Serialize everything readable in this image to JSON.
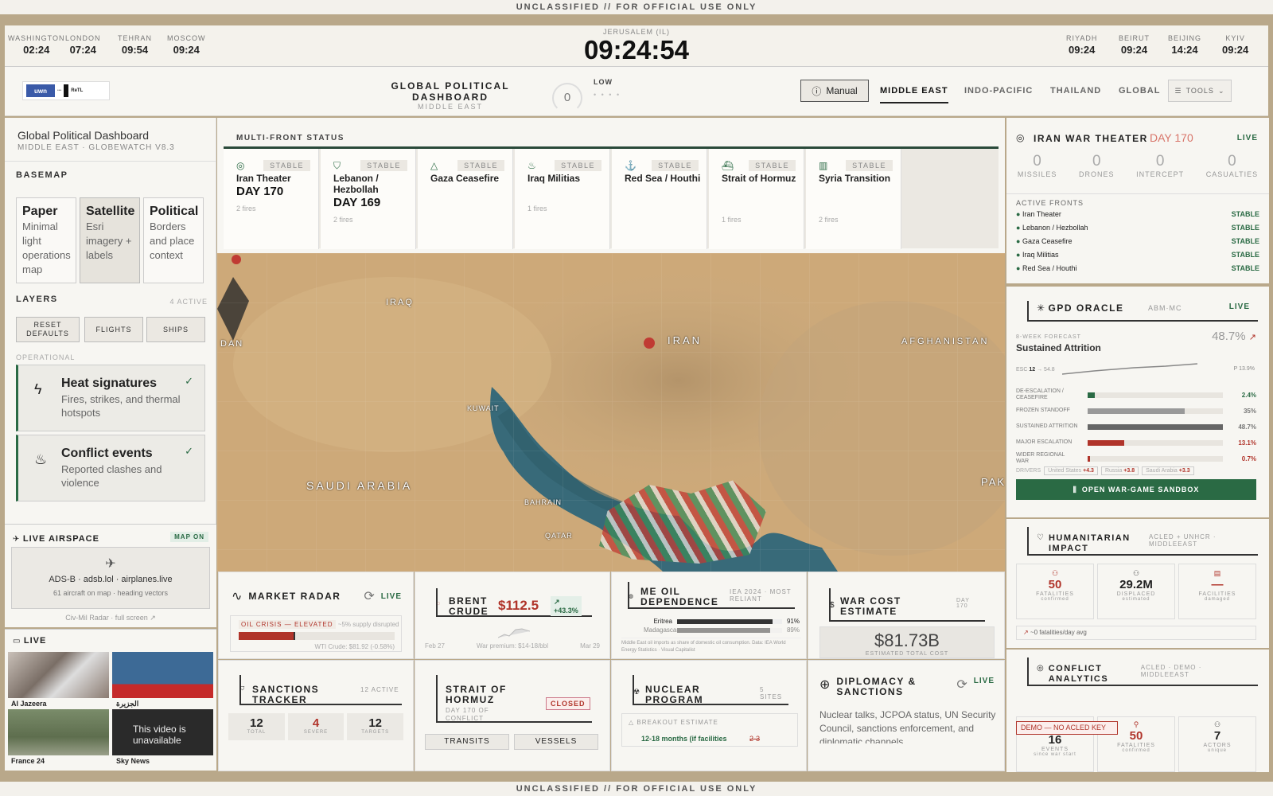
{
  "classification": "UNCLASSIFIED // FOR OFFICIAL USE ONLY",
  "clocks": [
    {
      "city": "WASHINGTON",
      "time": "02:24"
    },
    {
      "city": "LONDON",
      "time": "07:24"
    },
    {
      "city": "TEHRAN",
      "time": "09:54"
    },
    {
      "city": "MOSCOW",
      "time": "09:24"
    },
    {
      "city": "RIYADH",
      "time": "09:24"
    },
    {
      "city": "BEIRUT",
      "time": "09:24"
    },
    {
      "city": "BEIJING",
      "time": "14:24"
    },
    {
      "city": "KYIV",
      "time": "09:24"
    }
  ],
  "main_clock": {
    "city": "JERUSALEM (IL)",
    "time": "09:24:54"
  },
  "header": {
    "logos": {
      "uwn": "uwn",
      "alt": "ReTL"
    },
    "title": "GLOBAL POLITICAL DASHBOARD",
    "subtitle": "MIDDLE EAST",
    "gauge_value": "0",
    "risk_label": "LOW",
    "risk_dots": "• • • •",
    "manual": "Manual",
    "tabs": [
      "MIDDLE EAST",
      "INDO-PACIFIC",
      "THAILAND",
      "GLOBAL"
    ],
    "tools": "TOOLS"
  },
  "left": {
    "title": "Global Political Dashboard",
    "subtitle": "MIDDLE EAST · GLOBEWATCH V8.3",
    "basemap_h": "BASEMAP",
    "basemaps": [
      {
        "name": "Paper",
        "desc": "Minimal light operations map"
      },
      {
        "name": "Satellite",
        "desc": "Esri imagery + labels"
      },
      {
        "name": "Political",
        "desc": "Borders and place context"
      }
    ],
    "layers_h": "LAYERS",
    "layers_count": "4 ACTIVE",
    "buttons": [
      "RESET DEFAULTS",
      "FLIGHTS",
      "SHIPS"
    ],
    "operational": "OPERATIONAL",
    "layers": [
      {
        "name": "Heat signatures",
        "desc": "Fires, strikes, and thermal hotspots"
      },
      {
        "name": "Conflict events",
        "desc": "Reported clashes and violence"
      }
    ],
    "air": {
      "title": "LIVE AIRSPACE",
      "mapon": "MAP ON",
      "src": "ADS-B · adsb.lol · airplanes.live",
      "detail": "61 aircraft on map · heading vectors",
      "link": "Civ-Mil Radar · full screen"
    },
    "live": {
      "title": "LIVE",
      "videos": [
        "Al Jazeera",
        "الجزيرة",
        "France 24",
        "Sky News"
      ],
      "unavailable": "This video is unavailable"
    }
  },
  "multifront": {
    "title": "MULTI-FRONT STATUS",
    "fronts": [
      {
        "name": "Iran Theater",
        "day": "DAY 170",
        "fires": "2 fires",
        "status": "STABLE"
      },
      {
        "name": "Lebanon / Hezbollah",
        "day": "DAY 169",
        "fires": "2 fires",
        "status": "STABLE"
      },
      {
        "name": "Gaza Ceasefire",
        "day": "",
        "fires": "",
        "status": "STABLE"
      },
      {
        "name": "Iraq Militias",
        "day": "",
        "fires": "1 fires",
        "status": "STABLE"
      },
      {
        "name": "Red Sea / Houthi",
        "day": "",
        "fires": "",
        "status": "STABLE"
      },
      {
        "name": "Strait of Hormuz",
        "day": "",
        "fires": "1 fires",
        "status": "STABLE"
      },
      {
        "name": "Syria Transition",
        "day": "",
        "fires": "2 fires",
        "status": "STABLE"
      }
    ]
  },
  "map_labels": {
    "iraq": "IRAQ",
    "iran": "IRAN",
    "afghanistan": "AFGHANISTAN",
    "saudi": "SAUDI ARABIA",
    "kuwait": "KUWAIT",
    "bahrain": "BAHRAIN",
    "qatar": "QATAR",
    "dan": "DAN",
    "pak": "PAK"
  },
  "iran_war": {
    "title": "IRAN WAR THEATER",
    "day": "DAY 170",
    "live": "LIVE",
    "stats": [
      {
        "v": "0",
        "l": "MISSILES"
      },
      {
        "v": "0",
        "l": "DRONES"
      },
      {
        "v": "0",
        "l": "INTERCEPT"
      },
      {
        "v": "0",
        "l": "CASUALTIES"
      }
    ],
    "fronts_h": "ACTIVE FRONTS",
    "fronts": [
      {
        "n": "Iran Theater",
        "s": "STABLE"
      },
      {
        "n": "Lebanon / Hezbollah",
        "s": "STABLE"
      },
      {
        "n": "Gaza Ceasefire",
        "s": "STABLE"
      },
      {
        "n": "Iraq Militias",
        "s": "STABLE"
      },
      {
        "n": "Red Sea / Houthi",
        "s": "STABLE"
      }
    ]
  },
  "oracle": {
    "title": "GPD ORACLE",
    "model": "ABM·MC",
    "live": "LIVE",
    "forecast_lbl": "8-WEEK FORECAST",
    "forecast": "Sustained Attrition",
    "pct": "48.7%",
    "esc": "ESC",
    "esc_v": "12",
    "esc_v2": "54.8",
    "p_lbl": "P",
    "p_v": "13.9%",
    "bars": [
      {
        "l": "DE-ESCALATION / CEASEFIRE",
        "v": "2.4%",
        "f": 0.05,
        "c": "#2a6a44"
      },
      {
        "l": "FROZEN STANDOFF",
        "v": "35%",
        "f": 0.72,
        "c": "#999"
      },
      {
        "l": "SUSTAINED ATTRITION",
        "v": "48.7%",
        "f": 1,
        "c": "#666"
      },
      {
        "l": "MAJOR ESCALATION",
        "v": "13.1%",
        "f": 0.27,
        "c": "#b0342a"
      },
      {
        "l": "WIDER REGIONAL WAR",
        "v": "0.7%",
        "f": 0.01,
        "c": "#b0342a"
      }
    ],
    "drivers_lbl": "DRIVERS",
    "drivers": [
      {
        "n": "United States",
        "v": "+4.3"
      },
      {
        "n": "Russia",
        "v": "+3.8"
      },
      {
        "n": "Saudi Arabia",
        "v": "+3.3"
      }
    ],
    "btn": "OPEN WAR-GAME SANDBOX"
  },
  "humanitarian": {
    "title": "HUMANITARIAN IMPACT",
    "src": "ACLED + UNHCR · MIDDLEEAST",
    "stats": [
      {
        "v": "50",
        "l": "FATALITIES",
        "s": "confirmed"
      },
      {
        "v": "29.2M",
        "l": "DISPLACED",
        "s": "estimated"
      },
      {
        "v": "—",
        "l": "FACILITIES",
        "s": "damaged"
      }
    ],
    "trend": "~0 fatalities/day avg"
  },
  "conflict": {
    "title": "CONFLICT ANALYTICS",
    "src": "ACLED · DEMO · MIDDLEEAST",
    "demo": "DEMO — NO ACLED KEY",
    "stats": [
      {
        "v": "16",
        "l": "EVENTS",
        "s": "since war start"
      },
      {
        "v": "50",
        "l": "FATALITIES",
        "s": "confirmed"
      },
      {
        "v": "7",
        "l": "ACTORS",
        "s": "unique"
      }
    ]
  },
  "market": {
    "title": "MARKET RADAR",
    "live": "LIVE",
    "crisis": "OIL CRISIS — ELEVATED",
    "crisis_note": "~5% supply disrupted",
    "wti": "WTI Crude: $81.92 (-0.58%)",
    "crisis_level": 0.36
  },
  "brent": {
    "title": "BRENT CRUDE",
    "price": "$112.5",
    "change": "+43.3%",
    "from": "Feb 27",
    "premium": "War premium: $14-18/bbl",
    "to": "Mar 29"
  },
  "oil": {
    "title": "ME OIL DEPENDENCE",
    "src": "IEA 2024 · MOST RELIANT",
    "rows": [
      {
        "n": "Eritrea",
        "v": "91%",
        "f": 0.91
      },
      {
        "n": "Madagascar",
        "v": "89%",
        "f": 0.89
      }
    ],
    "note": "Middle East oil imports as share of domestic oil consumption. Data: IEA World Energy Statistics · Visual Capitalist"
  },
  "warcost": {
    "title": "WAR COST ESTIMATE",
    "day": "DAY 170",
    "value": "$81.73B",
    "sub": "ESTIMATED TOTAL COST"
  },
  "sanctions": {
    "title": "SANCTIONS TRACKER",
    "active": "12 ACTIVE",
    "stats": [
      {
        "v": "12",
        "l": "TOTAL"
      },
      {
        "v": "4",
        "l": "SEVERE"
      },
      {
        "v": "12",
        "l": "TARGETS"
      }
    ]
  },
  "hormuz": {
    "title": "STRAIT OF HORMUZ",
    "sub": "DAY 170 OF CONFLICT",
    "status": "CLOSED",
    "tabs": [
      "TRANSITS",
      "VESSELS"
    ]
  },
  "nuclear": {
    "title": "NUCLEAR PROGRAM",
    "sites": "5 SITES",
    "breakout": "BREAKOUT ESTIMATE",
    "estimate": "12-18 months (if facilities",
    "prior": "2-3"
  },
  "diplomacy": {
    "title": "DIPLOMACY & SANCTIONS",
    "live": "LIVE",
    "text": "Nuclear talks, JCPOA status, UN Security Council, sanctions enforcement, and diplomatic channels"
  },
  "footer_live": "LIVE"
}
